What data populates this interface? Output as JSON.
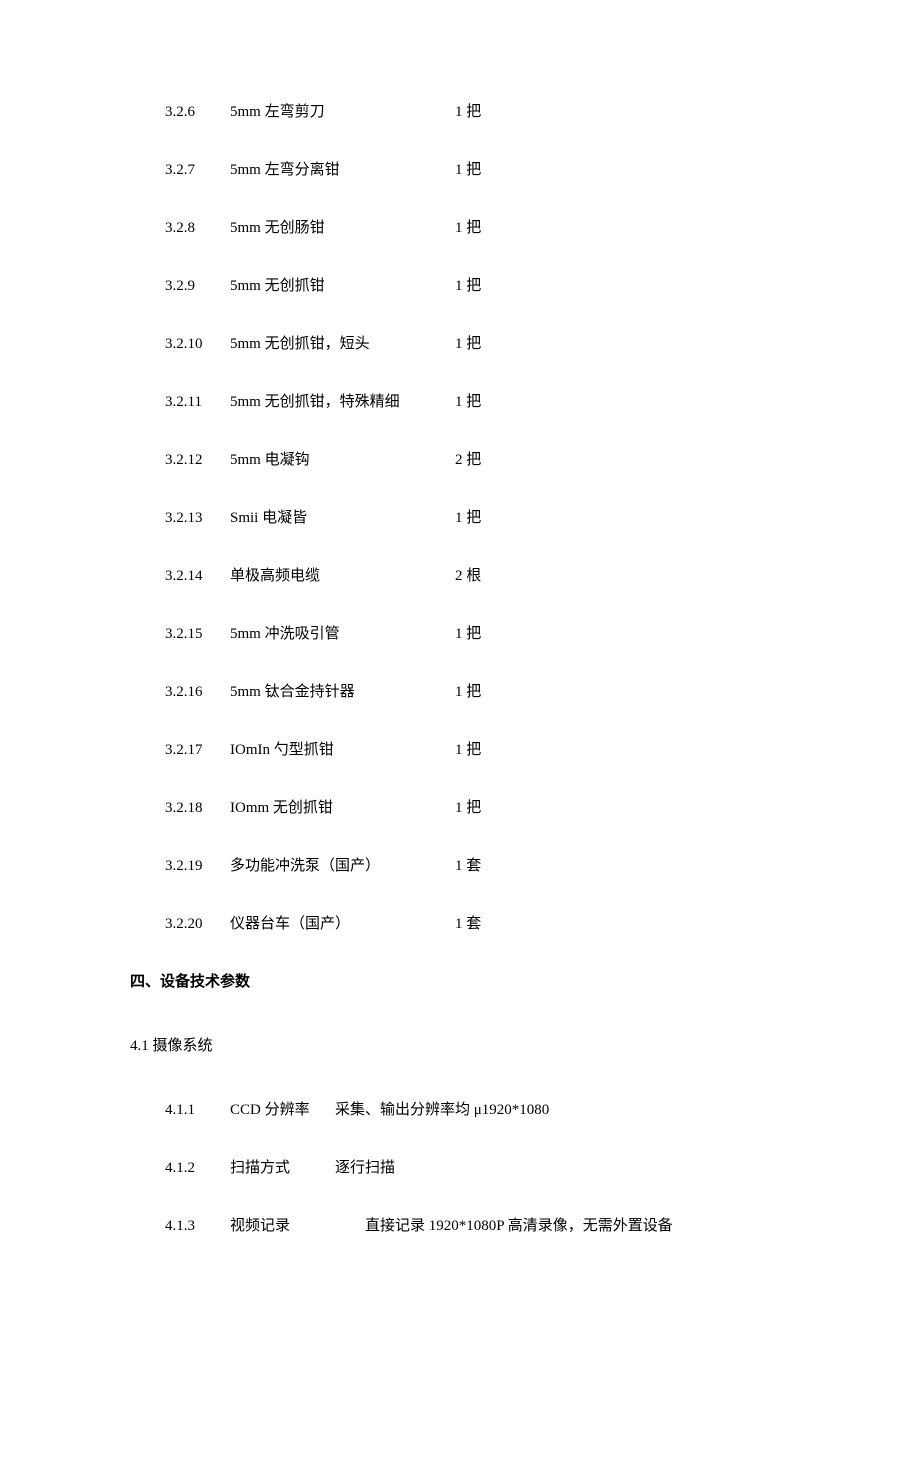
{
  "items": [
    {
      "num": "3.2.6",
      "desc": "5mm 左弯剪刀",
      "qty": "1 把"
    },
    {
      "num": "3.2.7",
      "desc": "5mm 左弯分离钳",
      "qty": "1 把"
    },
    {
      "num": "3.2.8",
      "desc": "5mm 无创肠钳",
      "qty": "1 把"
    },
    {
      "num": "3.2.9",
      "desc": "5mm 无创抓钳",
      "qty": "1 把"
    },
    {
      "num": "3.2.10",
      "desc": "5mm 无创抓钳，短头",
      "qty": "1 把"
    },
    {
      "num": "3.2.11",
      "desc": "5mm 无创抓钳，特殊精细",
      "qty": "1 把"
    },
    {
      "num": "3.2.12",
      "desc": "5mm 电凝钩",
      "qty": "2 把"
    },
    {
      "num": "3.2.13",
      "desc": "Smii 电凝皆",
      "qty": "1 把"
    },
    {
      "num": "3.2.14",
      "desc": "单极高频电缆",
      "qty": "2 根"
    },
    {
      "num": "3.2.15",
      "desc": "5mm 冲洗吸引管",
      "qty": "1 把"
    },
    {
      "num": "3.2.16",
      "desc": "5mm 钛合金持针器",
      "qty": "1 把"
    },
    {
      "num": "3.2.17",
      "desc": "IOmIn 勺型抓钳",
      "qty": "1 把"
    },
    {
      "num": "3.2.18",
      "desc": "IOmm 无创抓钳",
      "qty": "1 把"
    },
    {
      "num": "3.2.19",
      "desc": "多功能冲洗泵（国产）",
      "qty": "1 套"
    },
    {
      "num": "3.2.20",
      "desc": "仪器台车（国产）",
      "qty": "1 套"
    }
  ],
  "section_4_heading": "四、设备技术参数",
  "section_4_1_heading": "4.1 摄像系统",
  "specs": [
    {
      "num": "4.1.1",
      "label": "CCD 分辨率",
      "value": "采集、输出分辨率均 μ1920*1080",
      "indent": false
    },
    {
      "num": "4.1.2",
      "label": "扫描方式",
      "value": "逐行扫描",
      "indent": false
    },
    {
      "num": "4.1.3",
      "label": "视频记录",
      "value": "直接记录 1920*1080P 高清录像，无需外置设备",
      "indent": true
    }
  ]
}
